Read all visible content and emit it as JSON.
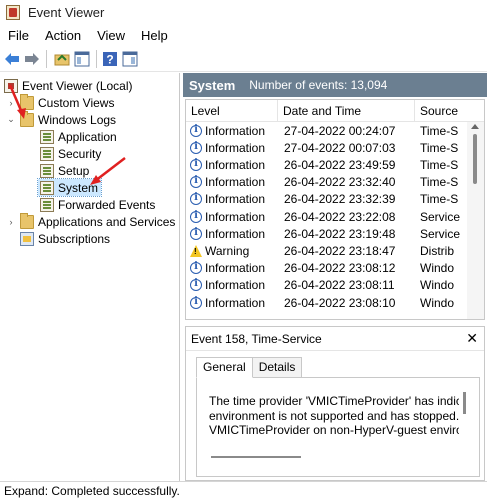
{
  "window": {
    "title": "Event Viewer"
  },
  "menu": [
    "File",
    "Action",
    "View",
    "Help"
  ],
  "tree": {
    "root": "Event Viewer (Local)",
    "custom_views": "Custom Views",
    "windows_logs": "Windows Logs",
    "application": "Application",
    "security": "Security",
    "setup": "Setup",
    "system": "System",
    "forwarded_events": "Forwarded Events",
    "apps_services": "Applications and Services Lo",
    "subscriptions": "Subscriptions"
  },
  "log_header": {
    "title": "System",
    "count": "Number of events: 13,094"
  },
  "table": {
    "columns": [
      "Level",
      "Date and Time",
      "Source"
    ],
    "rows": [
      {
        "level": "Information",
        "icon": "info",
        "date": "27-04-2022 00:24:07",
        "source": "Time-S"
      },
      {
        "level": "Information",
        "icon": "info",
        "date": "27-04-2022 00:07:03",
        "source": "Time-S"
      },
      {
        "level": "Information",
        "icon": "info",
        "date": "26-04-2022 23:49:59",
        "source": "Time-S"
      },
      {
        "level": "Information",
        "icon": "info",
        "date": "26-04-2022 23:32:40",
        "source": "Time-S"
      },
      {
        "level": "Information",
        "icon": "info",
        "date": "26-04-2022 23:32:39",
        "source": "Time-S"
      },
      {
        "level": "Information",
        "icon": "info",
        "date": "26-04-2022 23:22:08",
        "source": "Service"
      },
      {
        "level": "Information",
        "icon": "info",
        "date": "26-04-2022 23:19:48",
        "source": "Service"
      },
      {
        "level": "Warning",
        "icon": "warn",
        "date": "26-04-2022 23:18:47",
        "source": "Distrib"
      },
      {
        "level": "Information",
        "icon": "info",
        "date": "26-04-2022 23:08:12",
        "source": "Windo"
      },
      {
        "level": "Information",
        "icon": "info",
        "date": "26-04-2022 23:08:11",
        "source": "Windo"
      },
      {
        "level": "Information",
        "icon": "info",
        "date": "26-04-2022 23:08:10",
        "source": "Windo"
      }
    ]
  },
  "detail": {
    "title": "Event 158, Time-Service",
    "close": "✕",
    "tabs": [
      "General",
      "Details"
    ],
    "description": [
      "The time provider 'VMICTimeProvider' has indicate",
      "environment is not supported and has stopped. Th",
      "VMICTimeProvider on non-HyperV-guest environn"
    ]
  },
  "status": {
    "text": "Expand:  Completed successfully."
  },
  "colors": {
    "header_bar": "#6b7f91",
    "selection": "#cce8ff",
    "arrow": "#e02020"
  }
}
